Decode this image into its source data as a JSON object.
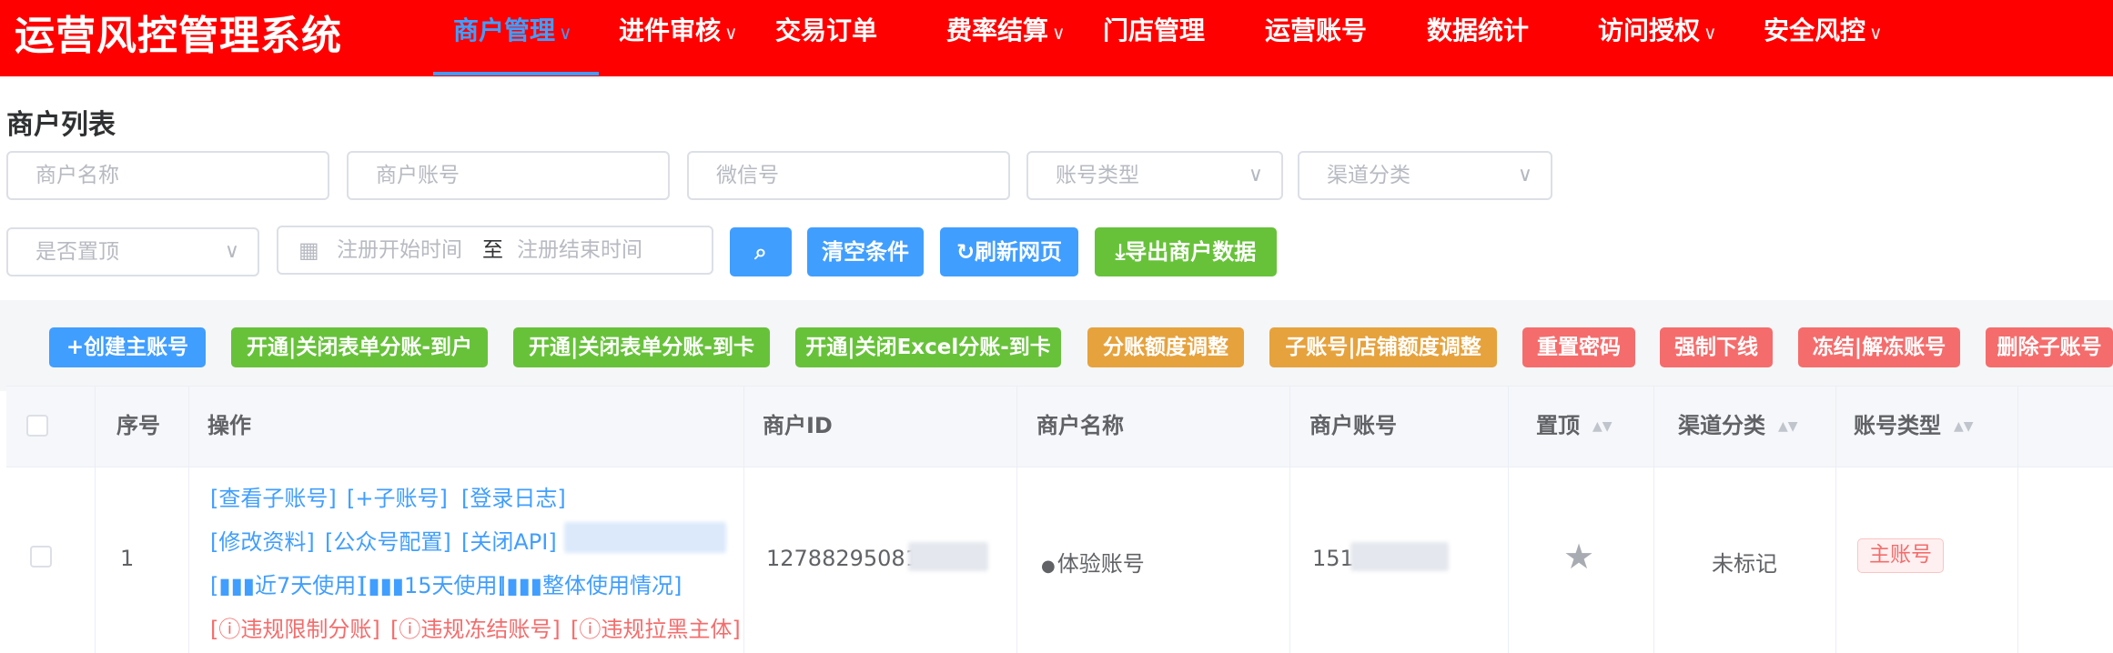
{
  "header": {
    "brand": "运营风控管理系统",
    "nav": [
      {
        "label": "商户管理",
        "chevron": "∨",
        "active": true
      },
      {
        "label": "进件审核",
        "chevron": "∨"
      },
      {
        "label": "交易订单",
        "chevron": ""
      },
      {
        "label": "费率结算",
        "chevron": "∨"
      },
      {
        "label": "门店管理",
        "chevron": ""
      },
      {
        "label": "运营账号",
        "chevron": ""
      },
      {
        "label": "数据统计",
        "chevron": ""
      },
      {
        "label": "访问授权",
        "chevron": "∨"
      },
      {
        "label": "安全风控",
        "chevron": "∨"
      }
    ],
    "colors": {
      "bar": "#ff0000",
      "active": "#409eff"
    }
  },
  "page": {
    "title": "商户列表"
  },
  "filters": {
    "merchant_name": "商户名称",
    "merchant_account": "商户账号",
    "wechat": "微信号",
    "account_type": "账号类型",
    "channel": "渠道分类",
    "pinned": "是否置顶",
    "date_start": "注册开始时间",
    "date_sep": "至",
    "date_end": "注册结束时间",
    "dropdown_arrow": "∨",
    "calendar_icon": "▦"
  },
  "actions": {
    "search_icon": "⌕",
    "clear": "清空条件",
    "refresh_icon": "↻",
    "refresh": "刷新网页",
    "export_icon": "⤓",
    "export": "导出商户数据"
  },
  "toolbar": {
    "create": "+创建主账号",
    "split_to_account": "开通|关闭表单分账-到户",
    "split_to_card": "开通|关闭表单分账-到卡",
    "excel_split_to_card": "开通|关闭Excel分账-到卡",
    "split_quota": "分账额度调整",
    "sub_quota": "子账号|店铺额度调整",
    "reset_password": "重置密码",
    "force_logout": "强制下线",
    "freeze": "冻结|解冻账号",
    "delete_sub": "删除子账号"
  },
  "table": {
    "columns": {
      "index": "序号",
      "operation": "操作",
      "merchant_id": "商户ID",
      "merchant_name": "商户名称",
      "merchant_account": "商户账号",
      "pinned": "置顶",
      "channel": "渠道分类",
      "account_type": "账号类型"
    },
    "sort_icon": "▲▼",
    "rows": [
      {
        "index": "1",
        "ops": {
          "view_sub": "[查看子账号]",
          "add_sub": "[+子账号]",
          "login_log": "[登录日志]",
          "edit": "[修改资料]",
          "official_account": "[公众号配置]",
          "close_api": "[关闭API]",
          "usage_7": "[▮▮▮近7天使用]",
          "usage_15": "[▮▮▮15天使用]",
          "usage_all": "[▮▮▮整体使用情况]",
          "limit_split": "[ⓘ违规限制分账]",
          "freeze_account": "[ⓘ违规冻结账号]",
          "blacklist": "[ⓘ违规拉黑主体]"
        },
        "merchant_id": "127882950812",
        "merchant_name": "体验账号",
        "merchant_account": "151",
        "pinned_icon": "★",
        "channel": "未标记",
        "account_type": "主账号"
      }
    ]
  }
}
